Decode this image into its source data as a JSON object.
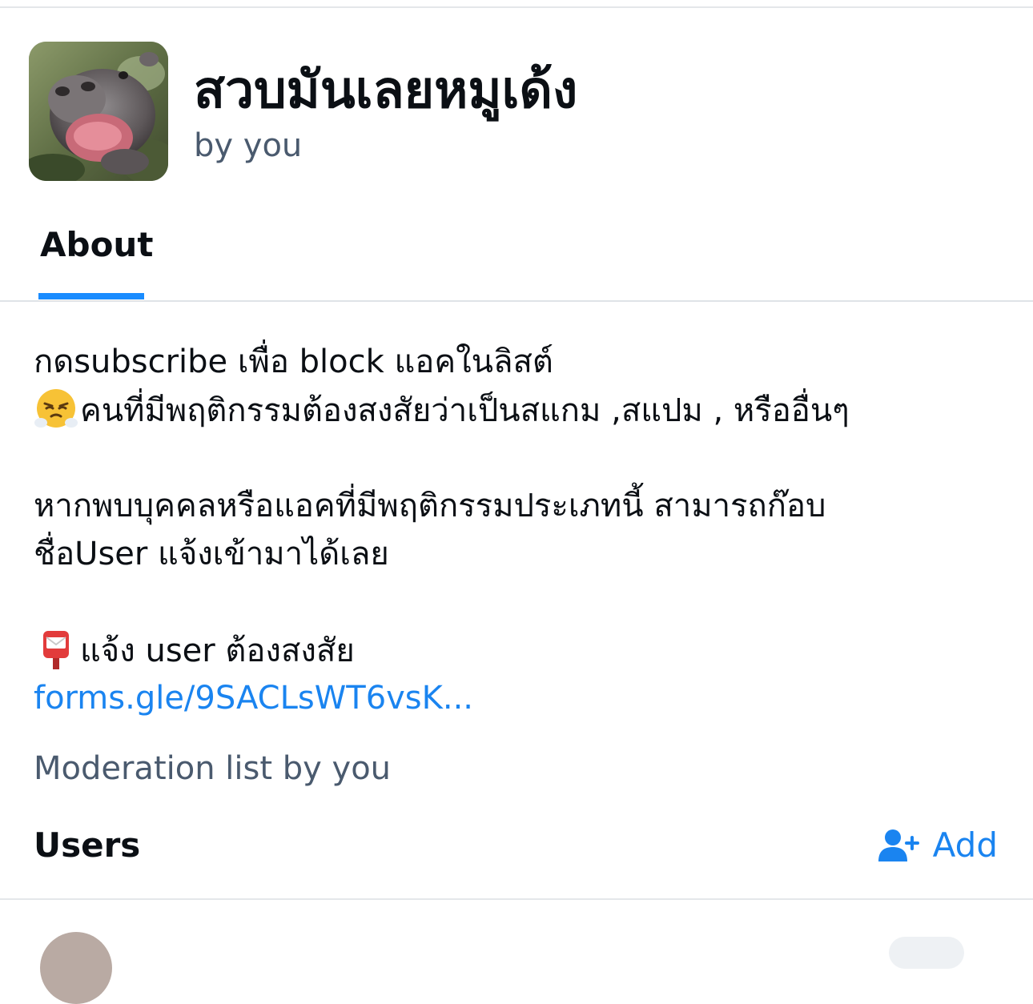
{
  "list": {
    "title": "สวบมันเลยหมูเด้ง",
    "byline": "by you",
    "avatar_description": "hippo-avatar"
  },
  "tabs": [
    {
      "label": "About",
      "active": true
    }
  ],
  "description": {
    "line1": "กดsubscribe เพื่อ block แอคในลิสต์",
    "line2_emoji": "face-with-steam-emoji",
    "line2": "คนที่มีพฤติกรรมต้องสงสัยว่าเป็นสแกม ,สแปม , หรืออื่นๆ",
    "line3": "หากพบบุคคลหรือแอคที่มีพฤติกรรมประเภทนี้ สามารถก๊อบ",
    "line4": "ชื่อUser แจ้งเข้ามาได้เลย",
    "line5_emoji": "postbox-emoji",
    "line5": "แจ้ง user ต้องสงสัย",
    "link": "forms.gle/9SACLsWT6vsK..."
  },
  "moderation_line": "Moderation list by you",
  "users_section": {
    "heading": "Users",
    "add_label": "Add",
    "add_icon": "add-user-icon"
  },
  "colors": {
    "accent": "#1a84f0",
    "tab_underline": "#1a8cff",
    "muted_text": "#4a5a6e",
    "divider": "#e4e7ea"
  }
}
